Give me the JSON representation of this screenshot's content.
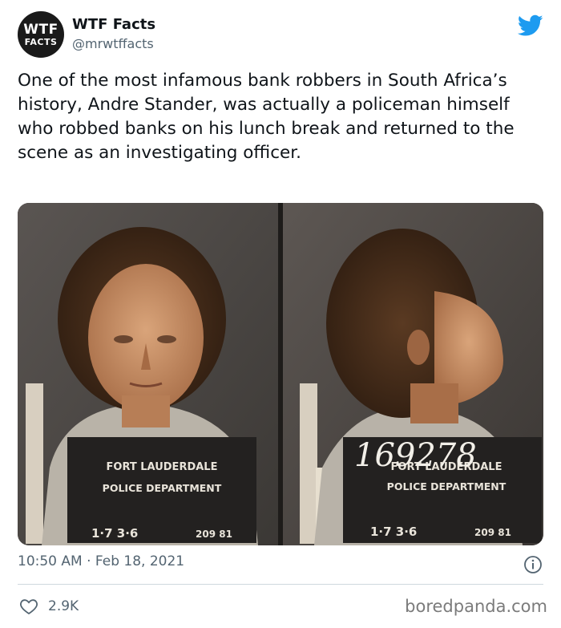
{
  "account": {
    "avatar_line1": "WTF",
    "avatar_line2": "FACTS",
    "name": "WTF Facts",
    "handle": "@mrwtffacts"
  },
  "tweet": {
    "text": "One of the most infamous bank robbers in South Africa’s history, Andre Stander, was actually a policeman himself who robbed banks on his lunch break and returned to the scene as an investigating officer.",
    "timestamp": "10:50 AM · Feb 18, 2021",
    "likes": "2.9K"
  },
  "photo": {
    "left_placard": {
      "line1": "FORT LAUDERDALE",
      "line2": "POLICE DEPARTMENT",
      "number_a": "1·7 3·6",
      "number_b": "209 81"
    },
    "right_placard": {
      "handwritten": "169278",
      "line1": "FORT LAUDERDALE",
      "line2": "POLICE DEPARTMENT",
      "number_a": "1·7 3·6",
      "number_b": "209 81"
    }
  },
  "watermark": "boredpanda.com",
  "colors": {
    "twitter_blue": "#1d9bf0",
    "secondary_text": "#536471"
  },
  "icons": {
    "brand": "twitter-bird-icon",
    "info": "info-icon",
    "like": "heart-icon"
  }
}
